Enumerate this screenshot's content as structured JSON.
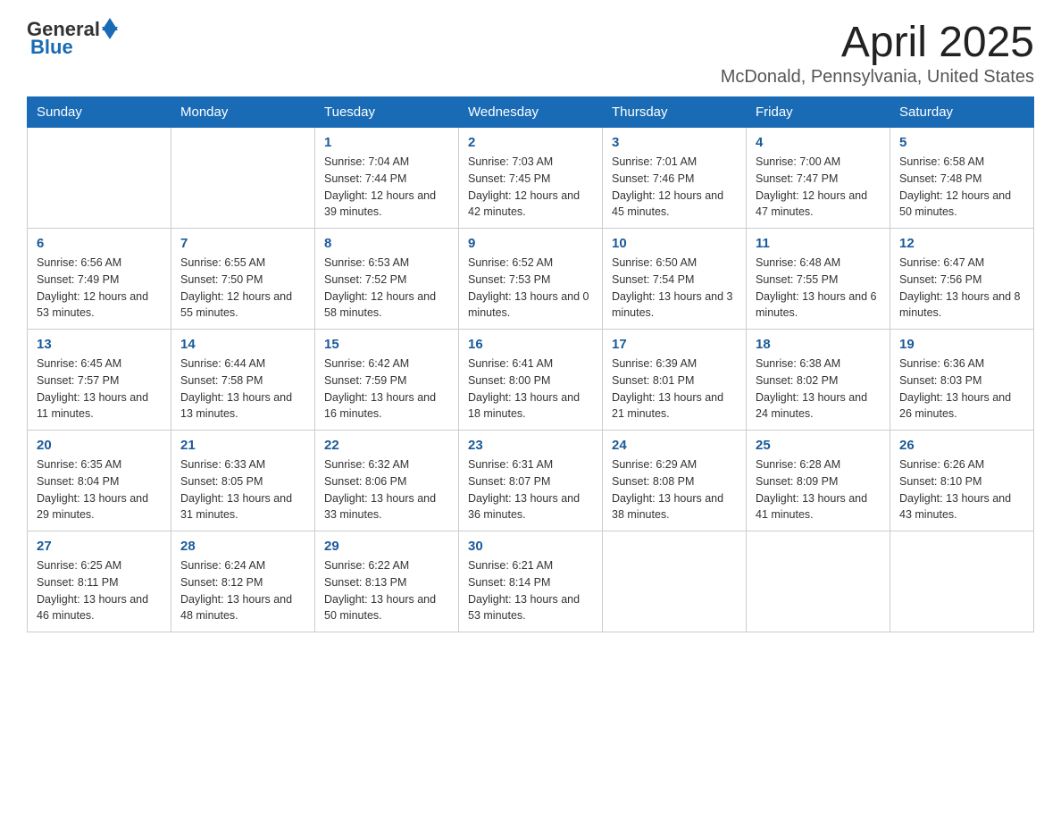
{
  "logo": {
    "general": "General",
    "blue": "Blue"
  },
  "header": {
    "month": "April 2025",
    "location": "McDonald, Pennsylvania, United States"
  },
  "weekdays": [
    "Sunday",
    "Monday",
    "Tuesday",
    "Wednesday",
    "Thursday",
    "Friday",
    "Saturday"
  ],
  "weeks": [
    [
      {
        "day": "",
        "info": ""
      },
      {
        "day": "",
        "info": ""
      },
      {
        "day": "1",
        "info": "Sunrise: 7:04 AM\nSunset: 7:44 PM\nDaylight: 12 hours and 39 minutes."
      },
      {
        "day": "2",
        "info": "Sunrise: 7:03 AM\nSunset: 7:45 PM\nDaylight: 12 hours and 42 minutes."
      },
      {
        "day": "3",
        "info": "Sunrise: 7:01 AM\nSunset: 7:46 PM\nDaylight: 12 hours and 45 minutes."
      },
      {
        "day": "4",
        "info": "Sunrise: 7:00 AM\nSunset: 7:47 PM\nDaylight: 12 hours and 47 minutes."
      },
      {
        "day": "5",
        "info": "Sunrise: 6:58 AM\nSunset: 7:48 PM\nDaylight: 12 hours and 50 minutes."
      }
    ],
    [
      {
        "day": "6",
        "info": "Sunrise: 6:56 AM\nSunset: 7:49 PM\nDaylight: 12 hours and 53 minutes."
      },
      {
        "day": "7",
        "info": "Sunrise: 6:55 AM\nSunset: 7:50 PM\nDaylight: 12 hours and 55 minutes."
      },
      {
        "day": "8",
        "info": "Sunrise: 6:53 AM\nSunset: 7:52 PM\nDaylight: 12 hours and 58 minutes."
      },
      {
        "day": "9",
        "info": "Sunrise: 6:52 AM\nSunset: 7:53 PM\nDaylight: 13 hours and 0 minutes."
      },
      {
        "day": "10",
        "info": "Sunrise: 6:50 AM\nSunset: 7:54 PM\nDaylight: 13 hours and 3 minutes."
      },
      {
        "day": "11",
        "info": "Sunrise: 6:48 AM\nSunset: 7:55 PM\nDaylight: 13 hours and 6 minutes."
      },
      {
        "day": "12",
        "info": "Sunrise: 6:47 AM\nSunset: 7:56 PM\nDaylight: 13 hours and 8 minutes."
      }
    ],
    [
      {
        "day": "13",
        "info": "Sunrise: 6:45 AM\nSunset: 7:57 PM\nDaylight: 13 hours and 11 minutes."
      },
      {
        "day": "14",
        "info": "Sunrise: 6:44 AM\nSunset: 7:58 PM\nDaylight: 13 hours and 13 minutes."
      },
      {
        "day": "15",
        "info": "Sunrise: 6:42 AM\nSunset: 7:59 PM\nDaylight: 13 hours and 16 minutes."
      },
      {
        "day": "16",
        "info": "Sunrise: 6:41 AM\nSunset: 8:00 PM\nDaylight: 13 hours and 18 minutes."
      },
      {
        "day": "17",
        "info": "Sunrise: 6:39 AM\nSunset: 8:01 PM\nDaylight: 13 hours and 21 minutes."
      },
      {
        "day": "18",
        "info": "Sunrise: 6:38 AM\nSunset: 8:02 PM\nDaylight: 13 hours and 24 minutes."
      },
      {
        "day": "19",
        "info": "Sunrise: 6:36 AM\nSunset: 8:03 PM\nDaylight: 13 hours and 26 minutes."
      }
    ],
    [
      {
        "day": "20",
        "info": "Sunrise: 6:35 AM\nSunset: 8:04 PM\nDaylight: 13 hours and 29 minutes."
      },
      {
        "day": "21",
        "info": "Sunrise: 6:33 AM\nSunset: 8:05 PM\nDaylight: 13 hours and 31 minutes."
      },
      {
        "day": "22",
        "info": "Sunrise: 6:32 AM\nSunset: 8:06 PM\nDaylight: 13 hours and 33 minutes."
      },
      {
        "day": "23",
        "info": "Sunrise: 6:31 AM\nSunset: 8:07 PM\nDaylight: 13 hours and 36 minutes."
      },
      {
        "day": "24",
        "info": "Sunrise: 6:29 AM\nSunset: 8:08 PM\nDaylight: 13 hours and 38 minutes."
      },
      {
        "day": "25",
        "info": "Sunrise: 6:28 AM\nSunset: 8:09 PM\nDaylight: 13 hours and 41 minutes."
      },
      {
        "day": "26",
        "info": "Sunrise: 6:26 AM\nSunset: 8:10 PM\nDaylight: 13 hours and 43 minutes."
      }
    ],
    [
      {
        "day": "27",
        "info": "Sunrise: 6:25 AM\nSunset: 8:11 PM\nDaylight: 13 hours and 46 minutes."
      },
      {
        "day": "28",
        "info": "Sunrise: 6:24 AM\nSunset: 8:12 PM\nDaylight: 13 hours and 48 minutes."
      },
      {
        "day": "29",
        "info": "Sunrise: 6:22 AM\nSunset: 8:13 PM\nDaylight: 13 hours and 50 minutes."
      },
      {
        "day": "30",
        "info": "Sunrise: 6:21 AM\nSunset: 8:14 PM\nDaylight: 13 hours and 53 minutes."
      },
      {
        "day": "",
        "info": ""
      },
      {
        "day": "",
        "info": ""
      },
      {
        "day": "",
        "info": ""
      }
    ]
  ]
}
